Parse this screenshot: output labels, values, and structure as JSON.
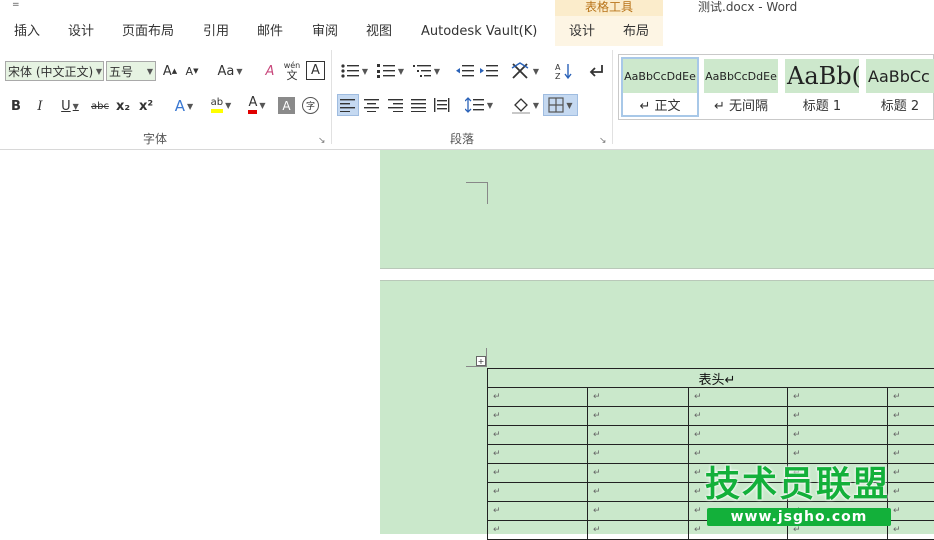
{
  "window": {
    "qat_arrow": "=",
    "context_header": "表格工具",
    "doc_title": "测试.docx - Word"
  },
  "tabs": [
    "插入",
    "设计",
    "页面布局",
    "引用",
    "邮件",
    "审阅",
    "视图",
    "Autodesk Vault(K)",
    "设计",
    "布局"
  ],
  "font_group": {
    "label": "字体",
    "font_name": "宋体 (中文正文)",
    "font_size": "五号",
    "grow": "A",
    "shrink": "A",
    "change_case": "Aa",
    "clear_format": "A",
    "phonetic_top": "wén",
    "phonetic_bottom": "文",
    "char_border": "A",
    "bold": "B",
    "italic": "I",
    "underline": "U",
    "strike": "abc",
    "subscript": "x₂",
    "superscript": "x²",
    "text_effect": "A",
    "highlight": "ab",
    "font_color": "A",
    "char_shading": "A",
    "enclose": "字"
  },
  "paragraph_group": {
    "label": "段落"
  },
  "styles_group": {
    "styles": [
      {
        "sample": "AaBbCcDdEe",
        "name": "↵ 正文"
      },
      {
        "sample": "AaBbCcDdEe",
        "name": "↵ 无间隔"
      },
      {
        "sample": "AaBb(",
        "name": "标题 1"
      },
      {
        "sample": "AaBbCc",
        "name": "标题 2"
      }
    ]
  },
  "document": {
    "table_header": "表头↵",
    "cell_mark": "↵",
    "move_handle": "+"
  },
  "watermark": {
    "title": "技术员联盟",
    "url": "www.jsgho.com"
  },
  "colors": {
    "page_bg": "#cae8cb",
    "context_tab": "#fbeccb",
    "highlight": "#ffff00",
    "font_red": "#e00000",
    "watermark_green": "#13b03a"
  }
}
